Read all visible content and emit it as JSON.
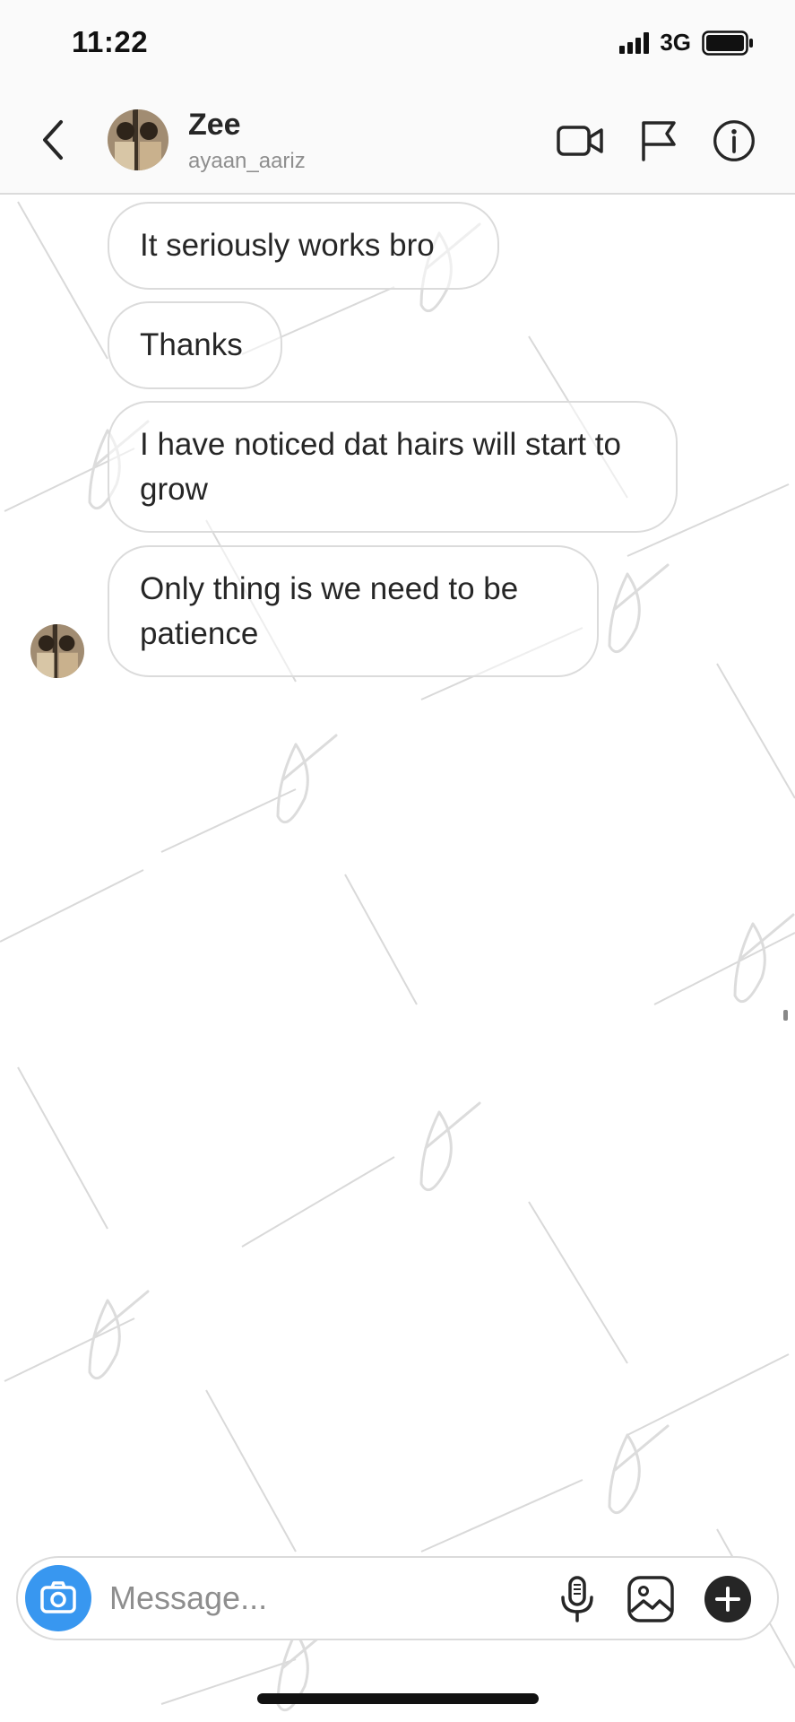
{
  "status_bar": {
    "time": "11:22",
    "network": "3G"
  },
  "header": {
    "contact_name": "Zee",
    "contact_username": "ayaan_aariz"
  },
  "messages": [
    {
      "text": "It seriously works bro"
    },
    {
      "text": "Thanks"
    },
    {
      "text": "I have noticed dat hairs will start to grow"
    },
    {
      "text": "Only thing is we need to be patience"
    }
  ],
  "composer": {
    "placeholder": "Message..."
  },
  "icons": {
    "back": "chevron-left-icon",
    "video_call": "video-camera-icon",
    "report": "flag-icon",
    "info": "info-icon",
    "camera": "camera-icon",
    "microphone": "microphone-icon",
    "gallery": "image-icon",
    "more": "plus-icon"
  },
  "colors": {
    "accent": "#3897f0",
    "bubble_border": "#dbdbdb",
    "text": "#262626",
    "secondary_text": "#8e8e8e"
  }
}
